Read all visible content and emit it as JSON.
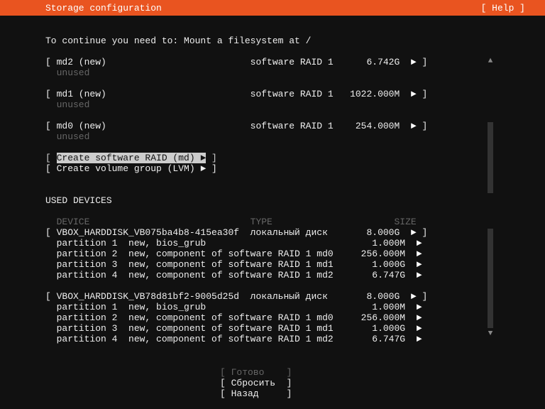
{
  "header": {
    "title": "Storage configuration",
    "help": "[ Help ]"
  },
  "prompt": "To continue you need to: Mount a filesystem at /",
  "devices": [
    {
      "name": "md2 (new)",
      "type": "software RAID 1",
      "size": "6.742G",
      "status": "unused"
    },
    {
      "name": "md1 (new)",
      "type": "software RAID 1",
      "size": "1022.000M",
      "status": "unused"
    },
    {
      "name": "md0 (new)",
      "type": "software RAID 1",
      "size": "254.000M",
      "status": "unused"
    }
  ],
  "actions": {
    "raid": "Create software RAID (md) ►",
    "lvm": "Create volume group (LVM) ►"
  },
  "used_header": "USED DEVICES",
  "cols": {
    "device": "DEVICE",
    "type": "TYPE",
    "size": "SIZE"
  },
  "disks": [
    {
      "name": "VBOX_HARDDISK_VB075ba4b8-415ea30f",
      "type": "локальный диск",
      "size": "8.000G",
      "parts": [
        {
          "label": "partition 1  new, bios_grub",
          "size": "1.000M"
        },
        {
          "label": "partition 2  new, component of software RAID 1 md0",
          "size": "256.000M"
        },
        {
          "label": "partition 3  new, component of software RAID 1 md1",
          "size": "1.000G"
        },
        {
          "label": "partition 4  new, component of software RAID 1 md2",
          "size": "6.747G"
        }
      ]
    },
    {
      "name": "VBOX_HARDDISK_VB78d81bf2-9005d25d",
      "type": "локальный диск",
      "size": "8.000G",
      "parts": [
        {
          "label": "partition 1  new, bios_grub",
          "size": "1.000M"
        },
        {
          "label": "partition 2  new, component of software RAID 1 md0",
          "size": "256.000M"
        },
        {
          "label": "partition 3  new, component of software RAID 1 md1",
          "size": "1.000G"
        },
        {
          "label": "partition 4  new, component of software RAID 1 md2",
          "size": "6.747G"
        }
      ]
    }
  ],
  "footer": {
    "done": "Готово",
    "reset": "Сбросить",
    "back": "Назад"
  },
  "glyph": {
    "tri": "►",
    "up": "▲",
    "down": "▼"
  }
}
